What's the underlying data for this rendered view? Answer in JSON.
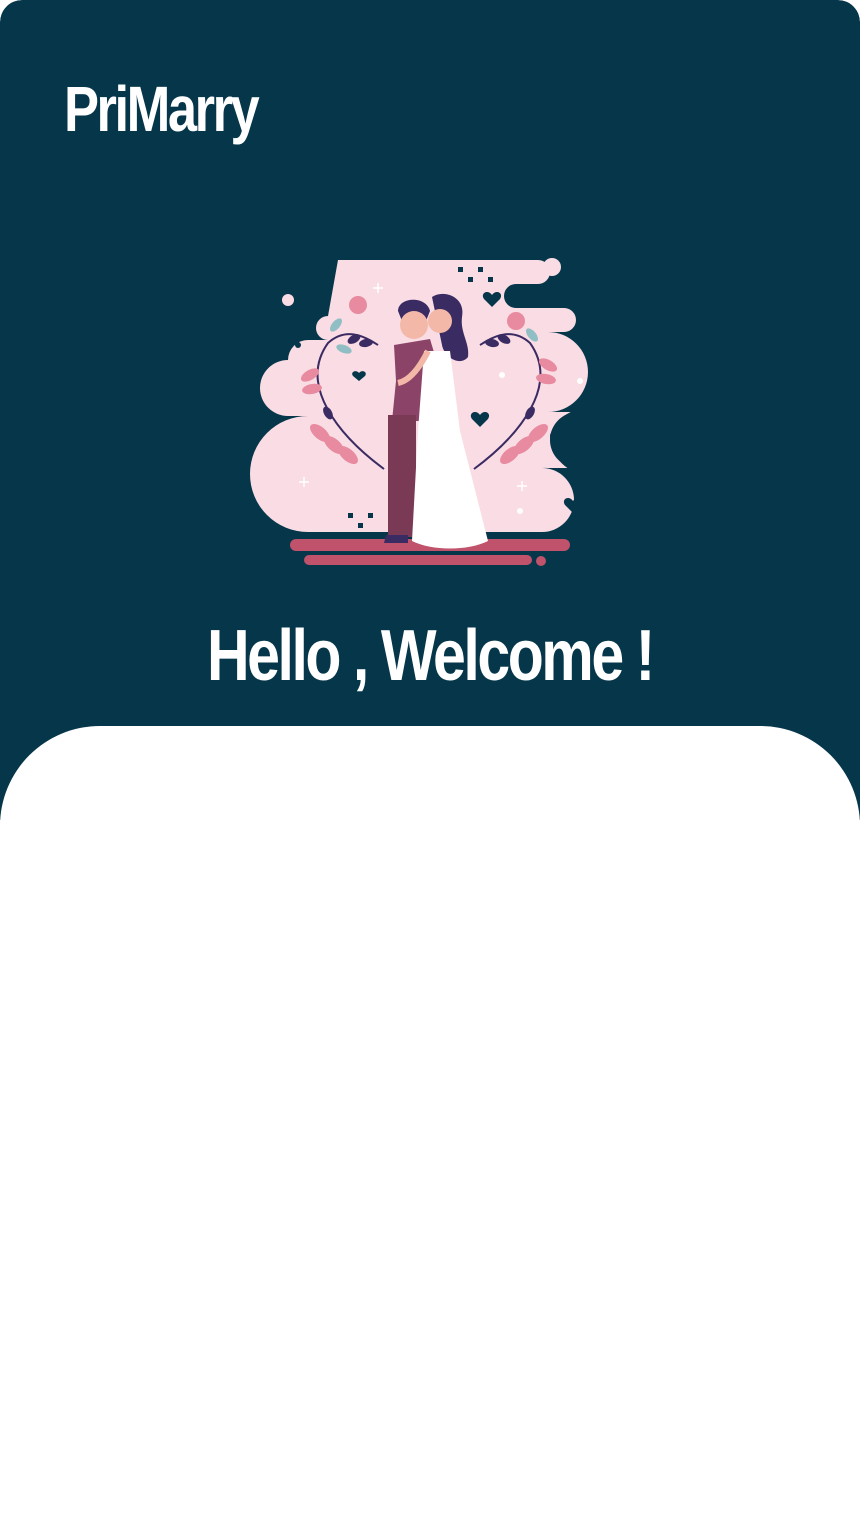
{
  "app": {
    "name": "PriMarry"
  },
  "hero": {
    "illustration_icon": "wedding-couple-illustration",
    "heading": "Hello , Welcome !"
  },
  "colors": {
    "header_bg": "#06364a",
    "sheet_bg": "#ffffff",
    "accent_pink": "#f9dce4",
    "accent_rose": "#c0526b"
  }
}
